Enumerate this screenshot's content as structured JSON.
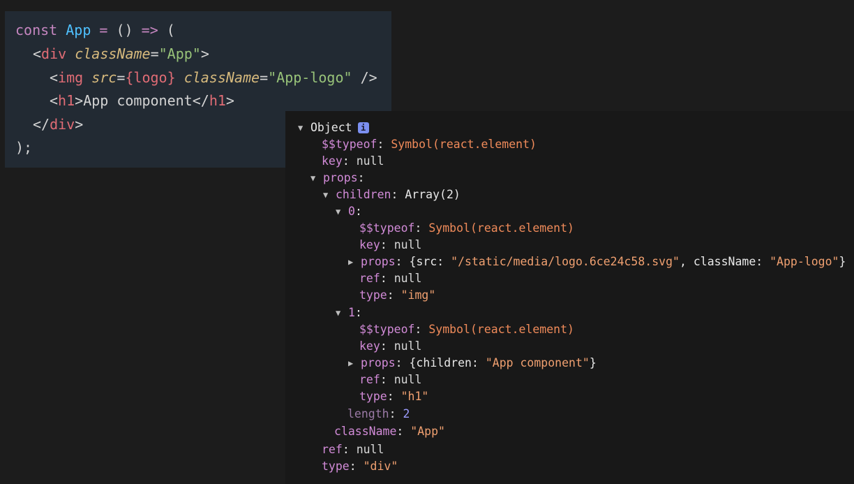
{
  "code": {
    "l1": {
      "kw": "const",
      "name": "App",
      "eq": " = ",
      "args": "()",
      "arrow": " => ",
      "open": "("
    },
    "l2": {
      "lt": "<",
      "tag": "div",
      "attr": "className",
      "eq": "=",
      "val": "\"App\"",
      "gt": ">"
    },
    "l3": {
      "lt": "<",
      "tag": "img",
      "attr1": "src",
      "eq1": "=",
      "expr": "{logo}",
      "attr2": "className",
      "eq2": "=",
      "val": "\"App-logo\"",
      "close": " />"
    },
    "l4": {
      "lt": "<",
      "tag": "h1",
      "gt": ">",
      "text": "App component",
      "lt2": "</",
      "tag2": "h1",
      "gt2": ">"
    },
    "l5": {
      "lt": "</",
      "tag": "div",
      "gt": ">"
    },
    "l6": {
      "text": ");"
    }
  },
  "console": {
    "root_label": "Object",
    "info_label": "i",
    "typeof_key": "$$typeof",
    "typeof_val": "Symbol(react.element)",
    "key_key": "key",
    "null_val": "null",
    "props_key": "props",
    "children_key": "children",
    "children_val": "Array(2)",
    "idx0": "0",
    "idx1": "1",
    "img_props_val_pre": "{src: ",
    "img_props_src": "\"/static/media/logo.6ce24c58.svg\"",
    "img_props_mid": ", className: ",
    "img_props_cls": "\"App-logo\"",
    "img_props_end": "}",
    "ref_key": "ref",
    "type_key": "type",
    "img_type": "\"img\"",
    "h1_props_pre": "{children: ",
    "h1_props_val": "\"App component\"",
    "h1_props_end": "}",
    "h1_type": "\"h1\"",
    "length_key": "length",
    "length_val": "2",
    "classname_key": "className",
    "classname_val": "\"App\"",
    "div_type": "\"div\""
  },
  "colors": {
    "code_bg": "#222a33",
    "console_bg": "#181818",
    "page_bg": "#1c1c1c"
  }
}
